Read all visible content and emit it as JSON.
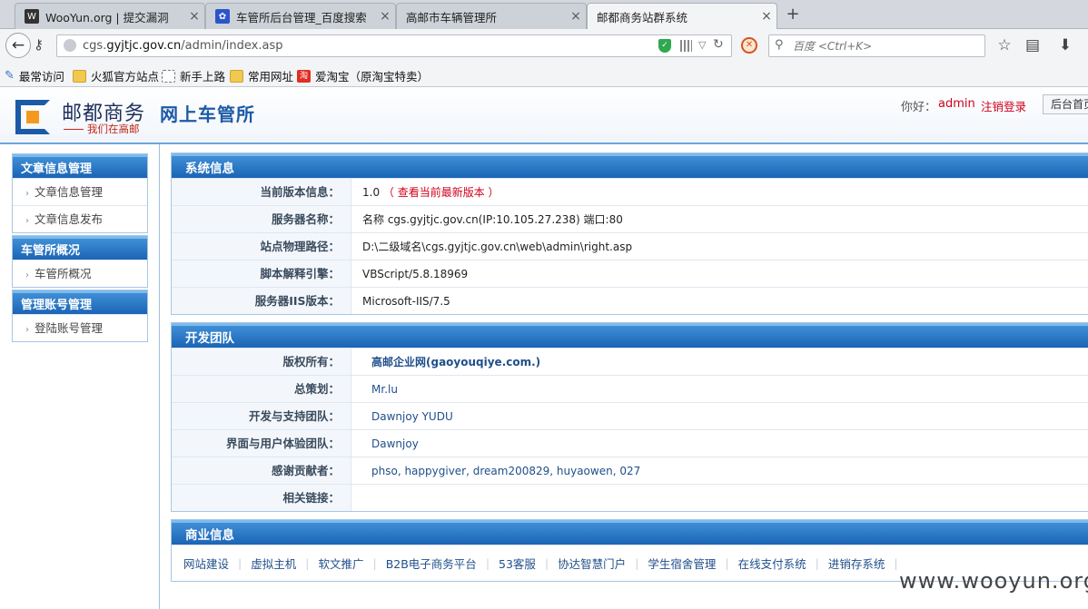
{
  "browser": {
    "tabs": [
      {
        "title": "WooYun.org | 提交漏洞",
        "icon": "wooyun-favicon"
      },
      {
        "title": "车管所后台管理_百度搜索",
        "icon": "baidu-favicon"
      },
      {
        "title": "高邮市车辆管理所",
        "icon": ""
      },
      {
        "title": "邮都商务站群系统",
        "icon": "",
        "active": true
      }
    ],
    "new_tab": "+",
    "close_glyph": "×",
    "url": {
      "prefix": "cgs.",
      "host": "gyjtjc.gov.cn",
      "path": "/admin/index.asp"
    },
    "search_placeholder": "百度 <Ctrl+K>",
    "bookmarks": [
      {
        "label": "最常访问",
        "icon": "star-icon"
      },
      {
        "label": "火狐官方站点",
        "icon": "folder-icon"
      },
      {
        "label": "新手上路",
        "icon": "page-icon"
      },
      {
        "label": "常用网址",
        "icon": "folder-icon"
      },
      {
        "label": "爱淘宝（原淘宝特卖）",
        "icon": "taobao-icon"
      }
    ]
  },
  "header": {
    "logo_text": "邮都商务",
    "logo_sub": "我们在高邮",
    "site_title": "网上车管所",
    "greeting": "你好：",
    "username": "admin",
    "logout": "注销登录",
    "home_button": "后台首页"
  },
  "sidebar": [
    {
      "title": "文章信息管理",
      "items": [
        "文章信息管理",
        "文章信息发布"
      ]
    },
    {
      "title": "车管所概况",
      "items": [
        "车管所概况"
      ]
    },
    {
      "title": "管理账号管理",
      "items": [
        "登陆账号管理"
      ]
    }
  ],
  "system_info": {
    "title": "系统信息",
    "rows": [
      {
        "label": "当前版本信息：",
        "value": "1.0",
        "link": "（ 查看当前最新版本 ）"
      },
      {
        "label": "服务器名称：",
        "value": "名称 cgs.gyjtjc.gov.cn(IP:10.105.27.238) 端口:80"
      },
      {
        "label": "站点物理路径：",
        "value": "D:\\二级域名\\cgs.gyjtjc.gov.cn\\web\\admin\\right.asp"
      },
      {
        "label": "脚本解释引擎：",
        "value": "VBScript/5.8.18969"
      },
      {
        "label": "服务器IIS版本：",
        "value": "Microsoft-IIS/7.5"
      }
    ]
  },
  "dev_team": {
    "title": "开发团队",
    "rows": [
      {
        "label": "版权所有：",
        "value": "高邮企业网(gaoyouqiye.com.)"
      },
      {
        "label": "总策划：",
        "value": "Mr.lu"
      },
      {
        "label": "开发与支持团队：",
        "value": " Dawnjoy YUDU"
      },
      {
        "label": "界面与用户体验团队：",
        "value": " Dawnjoy"
      },
      {
        "label": "感谢贡献者：",
        "value": " phso, happygiver, dream200829, huyaowen, 027"
      },
      {
        "label": "相关链接：",
        "value": ""
      }
    ]
  },
  "business": {
    "title": "商业信息",
    "links": [
      "网站建设",
      "虚拟主机",
      "软文推广",
      "B2B电子商务平台",
      "53客服",
      "协达智慧门户",
      "学生宿舍管理",
      "在线支付系统",
      "进销存系统"
    ],
    "separator": "|"
  },
  "watermark": "www.wooyun.org"
}
